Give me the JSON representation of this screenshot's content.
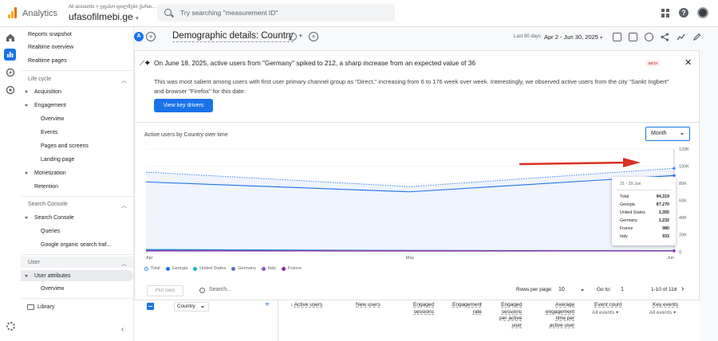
{
  "topbar": {
    "app_name": "Analytics",
    "account_path": "All accounts > უფასო ფილმები ქართ...",
    "property_name": "ufasofilmebi.ge",
    "search_placeholder": "Try searching \"measurement ID\""
  },
  "sidebar": {
    "reports_snapshot": "Reports snapshot",
    "realtime_overview": "Realtime overview",
    "realtime_pages": "Realtime pages",
    "lifecycle": "Life cycle",
    "acquisition": "Acquisition",
    "engagement": "Engagement",
    "overview": "Overview",
    "events": "Events",
    "pages_screens": "Pages and screens",
    "landing_page": "Landing page",
    "monetization": "Monetization",
    "retention": "Retention",
    "search_console_section": "Search Console",
    "search_console": "Search Console",
    "queries": "Queries",
    "organic": "Google organic search traf...",
    "user_section": "User",
    "user_attributes": "User attributes",
    "user_overview": "Overview",
    "library": "Library"
  },
  "header": {
    "avatar_letter": "A",
    "title": "Demographic details: Country",
    "date_label": "Last 90 days",
    "date_range": "Apr 2 - Jun 30, 2025"
  },
  "insight": {
    "title": "On June 18, 2025, active users from \"Germany\" spiked to 212, a sharp increase from an expected value of 36",
    "badge": "BETA",
    "body": "This was most salient among users with first user primary channel group as \"Direct,\" increasing from 6 to 176 week over week. Interestingly, we observed active users from the city \"Sankt Ingbert\" and browser \"Firefox\" for this date.",
    "button": "View key drivers"
  },
  "chart": {
    "title": "Active users by Country over time",
    "granularity": "Month",
    "tooltip": {
      "date": "31 - 29 Jun",
      "rows": [
        {
          "label": "Total",
          "value": "94,319"
        },
        {
          "label": "Georgia",
          "value": "87,270"
        },
        {
          "label": "United States",
          "value": "1,355"
        },
        {
          "label": "Germany",
          "value": "1,232"
        },
        {
          "label": "France",
          "value": "980"
        },
        {
          "label": "Italy",
          "value": "933"
        }
      ]
    }
  },
  "chart_data": {
    "type": "line",
    "title": "Active users by Country over time",
    "x": [
      "Apr",
      "May",
      "Jun"
    ],
    "ylim": [
      0,
      120000
    ],
    "y_ticks": [
      "120K",
      "100K",
      "80K",
      "60K",
      "40K",
      "20K",
      "0"
    ],
    "y_axis_side": "right",
    "grid": true,
    "legend": "bottom",
    "series": [
      {
        "name": "Total",
        "values": [
          93000,
          76000,
          97500
        ],
        "color": "#4285f4",
        "style": "dotted"
      },
      {
        "name": "Georgia",
        "values": [
          81500,
          70000,
          89000
        ],
        "color": "#1a73e8"
      },
      {
        "name": "United States",
        "values": [
          2800,
          1600,
          1355
        ],
        "color": "#12b5cb"
      },
      {
        "name": "Germany",
        "values": [
          1900,
          1400,
          1232
        ],
        "color": "#5c6bc0"
      },
      {
        "name": "Italy",
        "values": [
          1000,
          900,
          933
        ],
        "color": "#7e57c2"
      },
      {
        "name": "France",
        "values": [
          1100,
          950,
          980
        ],
        "color": "#8e24aa"
      }
    ]
  },
  "table": {
    "plot_rows": "Plot rows",
    "search_placeholder": "Search...",
    "rows_per_page_label": "Rows per page:",
    "rows_per_page": "10",
    "go_to_label": "Go to:",
    "go_to_value": "1",
    "range": "1-10 of 118",
    "dimension": "Country",
    "columns": {
      "active_users": "Active users",
      "new_users": "New users",
      "engaged_1": "Engaged",
      "engaged_2": "sessions",
      "engrate_1": "Engagement",
      "engrate_2": "rate",
      "esp_1": "Engaged",
      "esp_2": "sessions",
      "esp_3": "per active",
      "esp_4": "user",
      "aet_1": "Average",
      "aet_2": "engagement",
      "aet_3": "time per",
      "aet_4": "active user",
      "event_count": "Event count",
      "event_sub": "All events",
      "key_events": "Key events",
      "key_sub": "All events"
    }
  }
}
